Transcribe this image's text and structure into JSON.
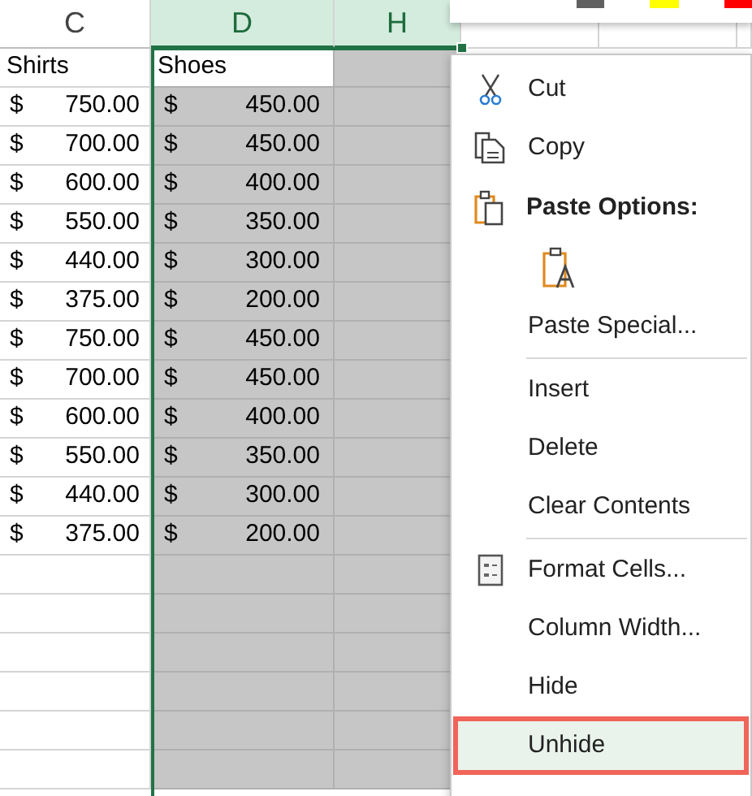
{
  "columns": [
    {
      "label": "C",
      "selected": false
    },
    {
      "label": "D",
      "selected": true
    },
    {
      "label": "H",
      "selected": true
    }
  ],
  "header_row": {
    "c": "Shirts",
    "d": "Shoes"
  },
  "rows": [
    {
      "c_symbol": "$",
      "c_amount": "750.00",
      "d_symbol": "$",
      "d_amount": "450.00"
    },
    {
      "c_symbol": "$",
      "c_amount": "700.00",
      "d_symbol": "$",
      "d_amount": "450.00"
    },
    {
      "c_symbol": "$",
      "c_amount": "600.00",
      "d_symbol": "$",
      "d_amount": "400.00"
    },
    {
      "c_symbol": "$",
      "c_amount": "550.00",
      "d_symbol": "$",
      "d_amount": "350.00"
    },
    {
      "c_symbol": "$",
      "c_amount": "440.00",
      "d_symbol": "$",
      "d_amount": "300.00"
    },
    {
      "c_symbol": "$",
      "c_amount": "375.00",
      "d_symbol": "$",
      "d_amount": "200.00"
    },
    {
      "c_symbol": "$",
      "c_amount": "750.00",
      "d_symbol": "$",
      "d_amount": "450.00"
    },
    {
      "c_symbol": "$",
      "c_amount": "700.00",
      "d_symbol": "$",
      "d_amount": "450.00"
    },
    {
      "c_symbol": "$",
      "c_amount": "600.00",
      "d_symbol": "$",
      "d_amount": "400.00"
    },
    {
      "c_symbol": "$",
      "c_amount": "550.00",
      "d_symbol": "$",
      "d_amount": "350.00"
    },
    {
      "c_symbol": "$",
      "c_amount": "440.00",
      "d_symbol": "$",
      "d_amount": "300.00"
    },
    {
      "c_symbol": "$",
      "c_amount": "375.00",
      "d_symbol": "$",
      "d_amount": "200.00"
    }
  ],
  "color_swatches": [
    {
      "color": "#606060"
    },
    {
      "color": "#ffff00"
    },
    {
      "color": "#ff0000"
    }
  ],
  "context_menu": [
    {
      "kind": "cut",
      "label": "Cut",
      "selected": false
    },
    {
      "kind": "copy",
      "label": "Copy",
      "selected": false
    },
    {
      "kind": "paste-header",
      "label": "Paste Options:"
    },
    {
      "kind": "paste-option"
    },
    {
      "kind": "plain",
      "label": "Paste Special...",
      "selected": false
    },
    {
      "kind": "separator"
    },
    {
      "kind": "plain",
      "label": "Insert",
      "selected": false
    },
    {
      "kind": "plain",
      "label": "Delete",
      "selected": false
    },
    {
      "kind": "plain",
      "label": "Clear Contents",
      "selected": false
    },
    {
      "kind": "separator"
    },
    {
      "kind": "format-cells",
      "label": "Format Cells...",
      "selected": false
    },
    {
      "kind": "plain",
      "label": "Column Width...",
      "selected": false
    },
    {
      "kind": "plain",
      "label": "Hide",
      "selected": false
    },
    {
      "kind": "plain",
      "label": "Unhide",
      "selected": true
    }
  ]
}
